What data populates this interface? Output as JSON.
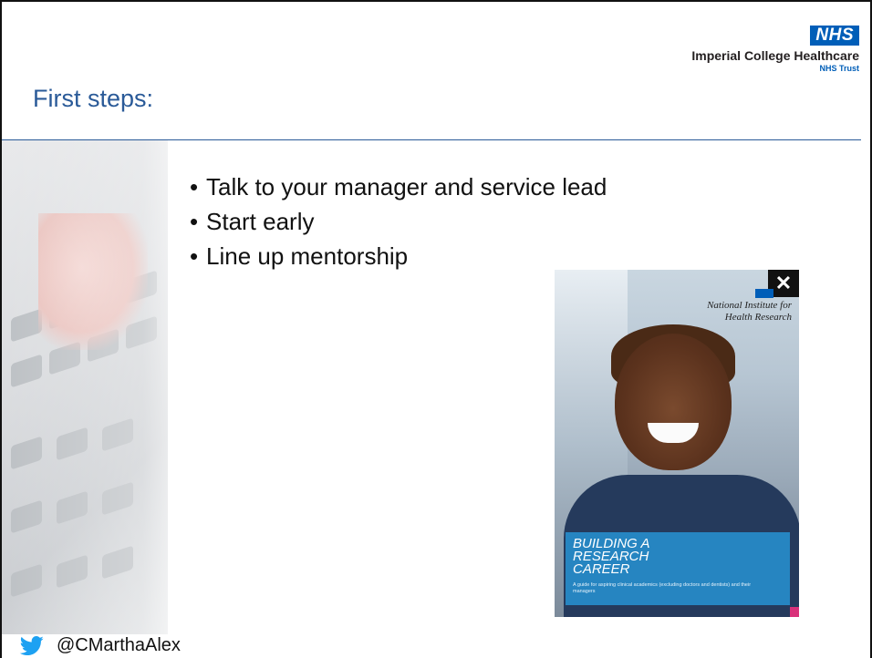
{
  "header": {
    "logo": {
      "badge": "NHS",
      "organization": "Imperial College Healthcare",
      "subtitle": "NHS Trust"
    },
    "title": "First steps:"
  },
  "bullets": [
    "Talk to your manager and service lead",
    "Start early",
    "Line up mentorship"
  ],
  "cover": {
    "close_symbol": "✕",
    "publisher_line1": "National Institute for",
    "publisher_line2": "Health Research",
    "panel_title": "Building a Research Career",
    "panel_subtitle": "A guide for aspiring clinical academics (excluding doctors and dentists) and their managers"
  },
  "footer": {
    "handle": "@CMarthaAlex",
    "icon": "twitter-icon"
  },
  "colors": {
    "title_blue": "#2a5a98",
    "nhs_blue": "#005eb8",
    "twitter_blue": "#1da1f2"
  }
}
